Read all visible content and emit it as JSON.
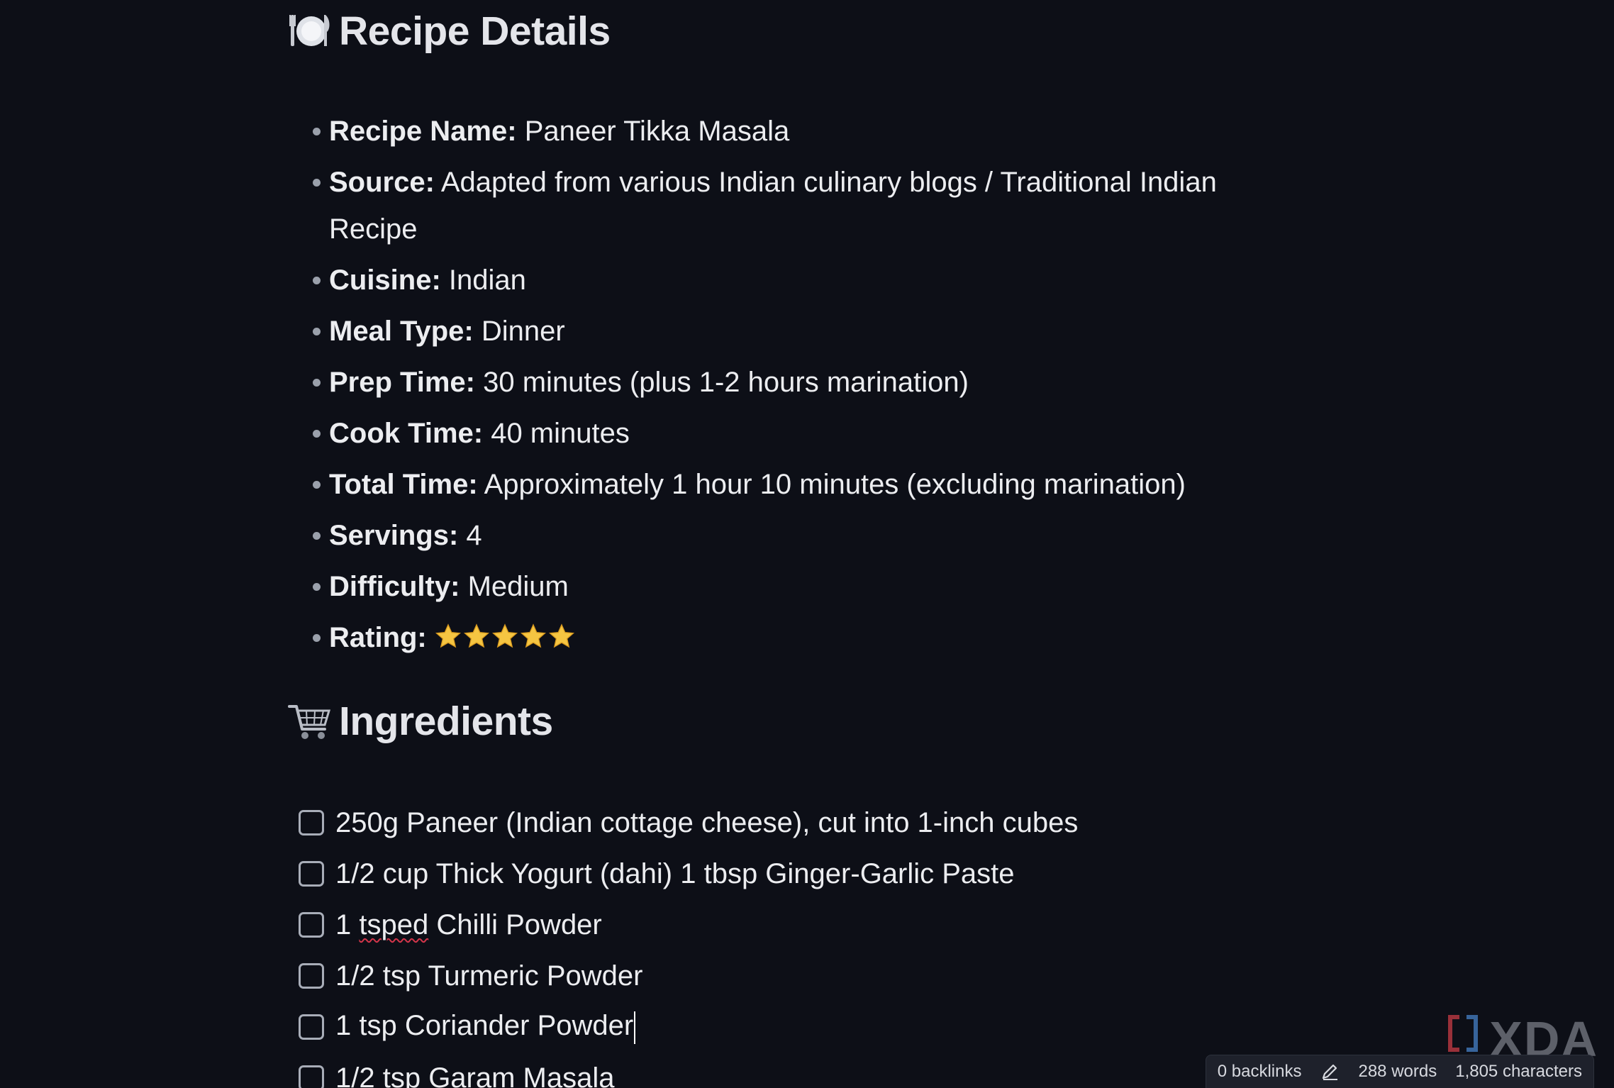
{
  "details_section": {
    "icon": "plate-cutlery-icon",
    "title": "Recipe Details",
    "items": [
      {
        "label": "Recipe Name:",
        "value": "Paneer Tikka Masala"
      },
      {
        "label": "Source:",
        "value": "Adapted from various Indian culinary blogs / Traditional Indian Recipe"
      },
      {
        "label": "Cuisine:",
        "value": "Indian"
      },
      {
        "label": "Meal Type:",
        "value": "Dinner"
      },
      {
        "label": "Prep Time:",
        "value": "30 minutes (plus 1-2 hours marination)"
      },
      {
        "label": "Cook Time:",
        "value": "40 minutes"
      },
      {
        "label": "Total Time:",
        "value": "Approximately 1 hour 10 minutes (excluding marination)"
      },
      {
        "label": "Servings:",
        "value": "4"
      },
      {
        "label": "Difficulty:",
        "value": "Medium"
      }
    ],
    "rating": {
      "label": "Rating:",
      "stars": 5,
      "max": 5
    }
  },
  "ingredients_section": {
    "icon": "shopping-cart-icon",
    "title": "Ingredients",
    "items": [
      {
        "text": "250g Paneer (Indian cottage cheese), cut into 1-inch cubes",
        "checked": false
      },
      {
        "text": "1/2 cup Thick Yogurt (dahi) 1 tbsp Ginger-Garlic Paste",
        "checked": false
      },
      {
        "text_before": "1 ",
        "text_misspelled": "tsped",
        "text_after": " Chilli Powder",
        "checked": false
      },
      {
        "text": "1/2 tsp Turmeric Powder",
        "checked": false
      },
      {
        "text": "1 tsp Coriander Powder",
        "checked": false
      },
      {
        "text": "1/2 tsp Garam Masala",
        "checked": false
      }
    ]
  },
  "status_bar": {
    "backlinks": "0 backlinks",
    "edit_icon": "pencil-icon",
    "words": "288 words",
    "characters": "1,805 characters"
  },
  "watermark": {
    "text": "XDA"
  },
  "colors": {
    "background": "#0d0f17",
    "text": "#ecedf0",
    "star": "#f5c542",
    "checkbox_border": "#a8adb8"
  }
}
